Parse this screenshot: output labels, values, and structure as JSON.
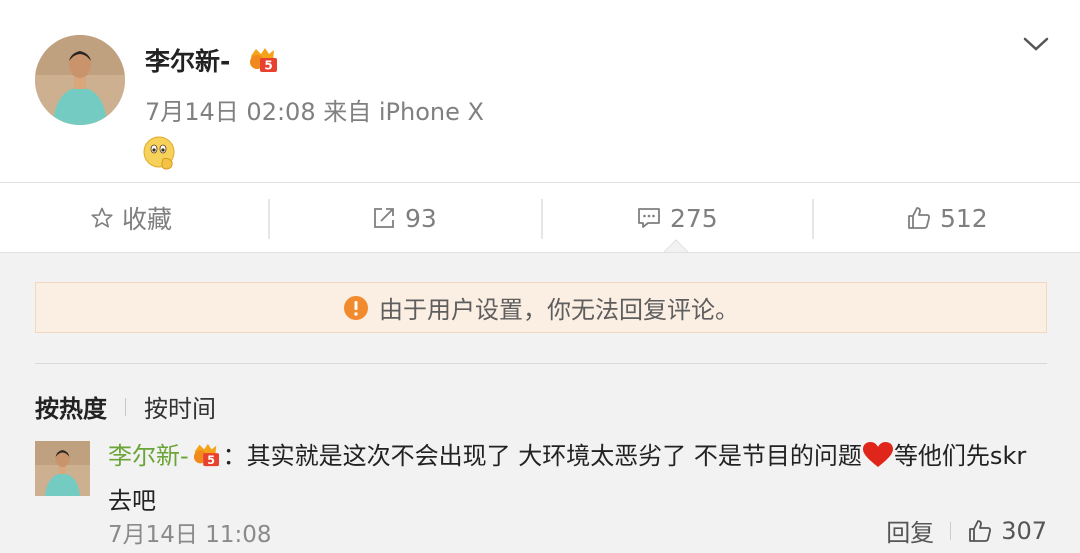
{
  "post": {
    "username": "李尔新-",
    "meta": "7月14日 02:08 来自 iPhone X"
  },
  "actions": {
    "favorite_label": "收藏",
    "repost_count": "93",
    "comment_count": "275",
    "like_count": "512"
  },
  "notice": "由于用户设置，你无法回复评论。",
  "sort": {
    "hot": "按热度",
    "time": "按时间"
  },
  "comment": {
    "username": "李尔新-",
    "text_before": "：其实就是这次不会出现了 大环境太恶劣了 不是节目的问题",
    "text_after": "等他们先skr去吧",
    "time": "7月14日 11:08",
    "reply_label": "回复",
    "like_count": "307"
  },
  "colors": {
    "username_green": "#6ba437",
    "notice_bg": "#fbeee3",
    "notice_icon": "#f28a2e",
    "heart": "#e0261b"
  },
  "icons": [
    "chevron-down-icon",
    "star-icon",
    "repost-icon",
    "comment-icon",
    "thumb-up-icon",
    "warning-icon",
    "vip-badge-icon",
    "heart-icon",
    "smile-emoji-icon"
  ]
}
